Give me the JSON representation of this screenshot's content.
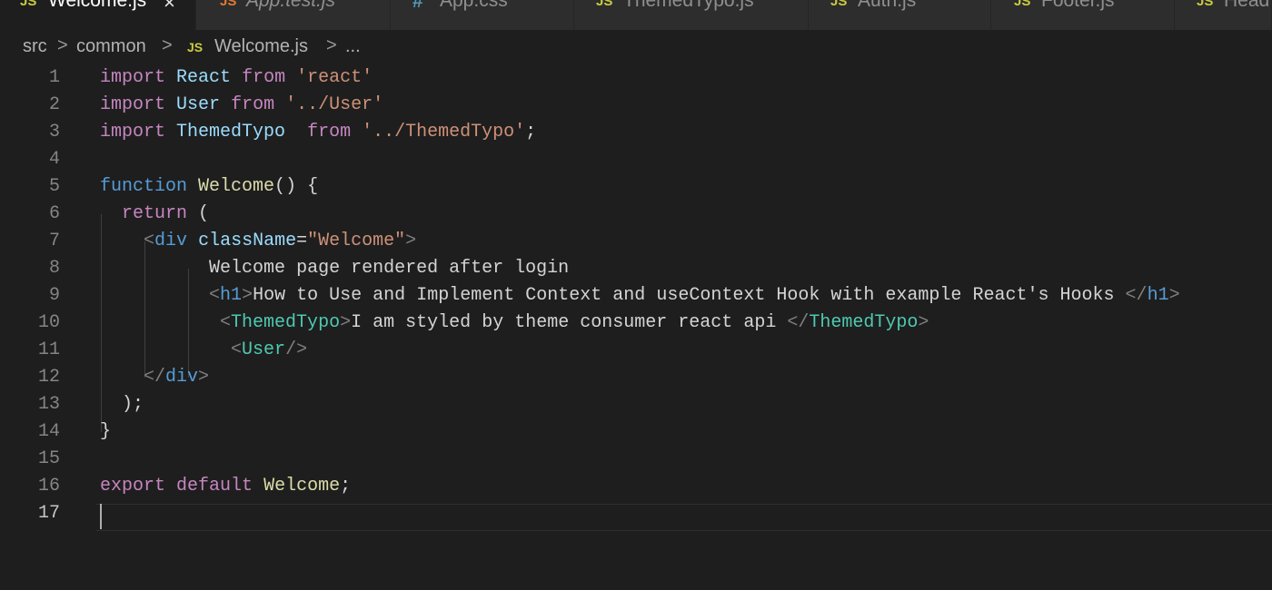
{
  "tabs": [
    {
      "icon": "JS",
      "label": "Welcome.js",
      "close": "×"
    },
    {
      "icon": "JS",
      "label": "App.test.js"
    },
    {
      "icon": "#",
      "label": "App.css"
    },
    {
      "icon": "JS",
      "label": "ThemedTypo.js"
    },
    {
      "icon": "JS",
      "label": "Auth.js"
    },
    {
      "icon": "JS",
      "label": "Footer.js"
    },
    {
      "icon": "JS",
      "label": "Head"
    }
  ],
  "breadcrumb": {
    "parts": [
      "src",
      "common",
      "Welcome.js",
      "..."
    ],
    "separator": ">",
    "file_icon": "JS"
  },
  "editor": {
    "line_numbers": [
      "1",
      "2",
      "3",
      "4",
      "5",
      "6",
      "7",
      "8",
      "9",
      "10",
      "11",
      "12",
      "13",
      "14",
      "15",
      "16",
      "17"
    ],
    "lines": [
      {
        "text": "import React from 'react'"
      },
      {
        "text": "import User from '../User'"
      },
      {
        "text": "import ThemedTypo  from '../ThemedTypo';"
      },
      {
        "text": ""
      },
      {
        "text": "function Welcome() {"
      },
      {
        "text": "  return ("
      },
      {
        "text": "    <div className=\"Welcome\">"
      },
      {
        "text": "          Welcome page rendered after login"
      },
      {
        "text": "          <h1>How to Use and Implement Context and useContext Hook with example React's Hooks </h1>"
      },
      {
        "text": "           <ThemedTypo>I am styled by theme consumer react api </ThemedTypo>"
      },
      {
        "text": "            <User/>"
      },
      {
        "text": "    </div>"
      },
      {
        "text": "  );"
      },
      {
        "text": "}"
      },
      {
        "text": ""
      },
      {
        "text": "export default Welcome;"
      },
      {
        "text": ""
      }
    ]
  },
  "colors": {
    "background": "#1e1e1e",
    "keyword": "#c586c0",
    "storage": "#569cd6",
    "identifier": "#9cdcfe",
    "function": "#dcdcaa",
    "string": "#ce9178",
    "component": "#4ec9b0",
    "js_icon": "#cbcb41",
    "css_icon": "#519aba"
  }
}
